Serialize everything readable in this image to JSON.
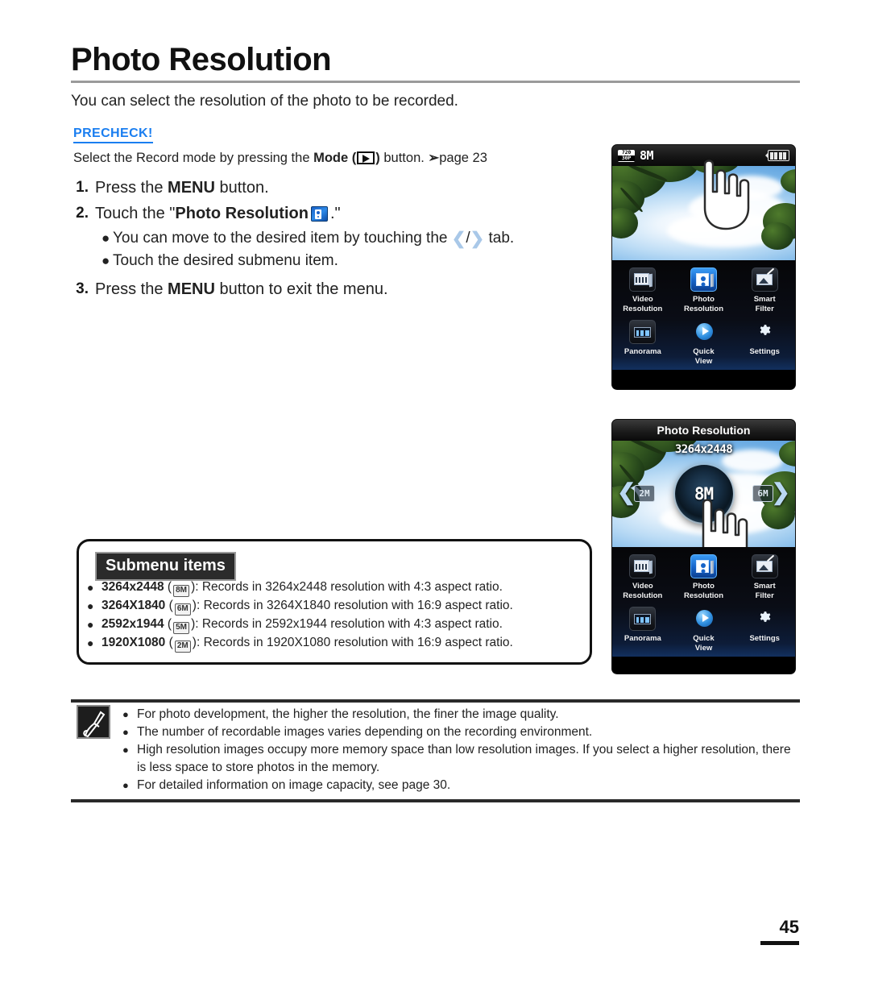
{
  "page": {
    "title": "Photo Resolution",
    "intro": "You can select the resolution of the photo to be recorded.",
    "number": "45"
  },
  "precheck": {
    "label": "PRECHECK!",
    "text_before": "Select the Record mode by pressing the ",
    "bold_mode": "Mode",
    "paren_open": "(",
    "paren_close": ")",
    "text_after": " button. ",
    "page_ref": "page 23",
    "mode_icon": "play-mode-icon"
  },
  "steps": [
    {
      "num": "1.",
      "text_before": "Press the ",
      "bold": "MENU",
      "text_after": " button."
    },
    {
      "num": "2.",
      "text_before": "Touch the \"",
      "bold": "Photo Resolution",
      "text_after": ".\"",
      "icon": "photo-resolution-icon",
      "bullets": [
        {
          "before": "You can move to the desired item by touching the ",
          "left_chev": "❮",
          "sep": "/",
          "right_chev": "❯",
          "after": " tab."
        },
        {
          "before": "Touch the desired submenu item.",
          "left_chev": "",
          "sep": "",
          "right_chev": "",
          "after": ""
        }
      ]
    },
    {
      "num": "3.",
      "text_before": "Press the ",
      "bold": "MENU",
      "text_after": " button to exit the menu."
    }
  ],
  "submenu": {
    "heading": "Submenu items",
    "items": [
      {
        "resolution": "3264x2448",
        "badge": "8M",
        "description": ": Records in 3264x2448 resolution with 4:3 aspect ratio."
      },
      {
        "resolution": "3264X1840",
        "badge": "6M",
        "description": ": Records in 3264X1840 resolution with 16:9 aspect ratio."
      },
      {
        "resolution": "2592x1944",
        "badge": "5M",
        "description": ": Records in 2592x1944 resolution with 4:3 aspect ratio."
      },
      {
        "resolution": "1920X1080",
        "badge": "2M",
        "description": ": Records in 1920X1080 resolution with 16:9 aspect ratio."
      }
    ]
  },
  "notes": {
    "icon": "note-pen-icon",
    "items": [
      "For photo development, the higher the resolution, the finer the image quality.",
      "The number of recordable images varies depending on the recording environment.",
      "High resolution images occupy more memory space than low resolution images. If you select a higher resolution, there is less space to store photos in the memory.",
      "For detailed information on image capacity, see page 30."
    ]
  },
  "screen1": {
    "status": {
      "video_res_top": "720",
      "video_res_bottom": "30P",
      "photo_res": "8M",
      "battery": "battery-full-icon"
    },
    "menu": [
      {
        "label": "Video\nResolution",
        "label_line1": "Video",
        "label_line2": "Resolution",
        "icon": "video-resolution-icon",
        "selected": false
      },
      {
        "label": "Photo Resolution",
        "label_line1": "Photo",
        "label_line2": "Resolution",
        "icon": "photo-resolution-icon",
        "selected": true
      },
      {
        "label": "Smart Filter",
        "label_line1": "Smart",
        "label_line2": "Filter",
        "icon": "smart-filter-icon",
        "selected": false
      },
      {
        "label": "Panorama",
        "label_line1": "Panorama",
        "label_line2": "",
        "icon": "panorama-icon",
        "selected": false
      },
      {
        "label": "Quick View",
        "label_line1": "Quick",
        "label_line2": "View",
        "icon": "quick-view-icon",
        "selected": false
      },
      {
        "label": "Settings",
        "label_line1": "Settings",
        "label_line2": "",
        "icon": "settings-gear-icon",
        "selected": false
      }
    ]
  },
  "screen2": {
    "title": "Photo Resolution",
    "selected_value": "3264x2448",
    "dial_label": "8M",
    "left_option": "2M",
    "right_option": "6M",
    "left_nav": "❮",
    "right_nav": "❯",
    "menu": [
      {
        "label_line1": "Video",
        "label_line2": "Resolution",
        "icon": "video-resolution-icon",
        "selected": false
      },
      {
        "label_line1": "Photo",
        "label_line2": "Resolution",
        "icon": "photo-resolution-icon",
        "selected": true
      },
      {
        "label_line1": "Smart",
        "label_line2": "Filter",
        "icon": "smart-filter-icon",
        "selected": false
      },
      {
        "label_line1": "Panorama",
        "label_line2": "",
        "icon": "panorama-icon",
        "selected": false
      },
      {
        "label_line1": "Quick",
        "label_line2": "View",
        "icon": "quick-view-icon",
        "selected": false
      },
      {
        "label_line1": "Settings",
        "label_line2": "",
        "icon": "settings-gear-icon",
        "selected": false
      }
    ]
  },
  "colors": {
    "precheck_blue": "#1a7ef0",
    "chevron_blue": "#a9c8e8",
    "tile_selected": "#1663c8",
    "rule_gray": "#9a9a9a"
  }
}
